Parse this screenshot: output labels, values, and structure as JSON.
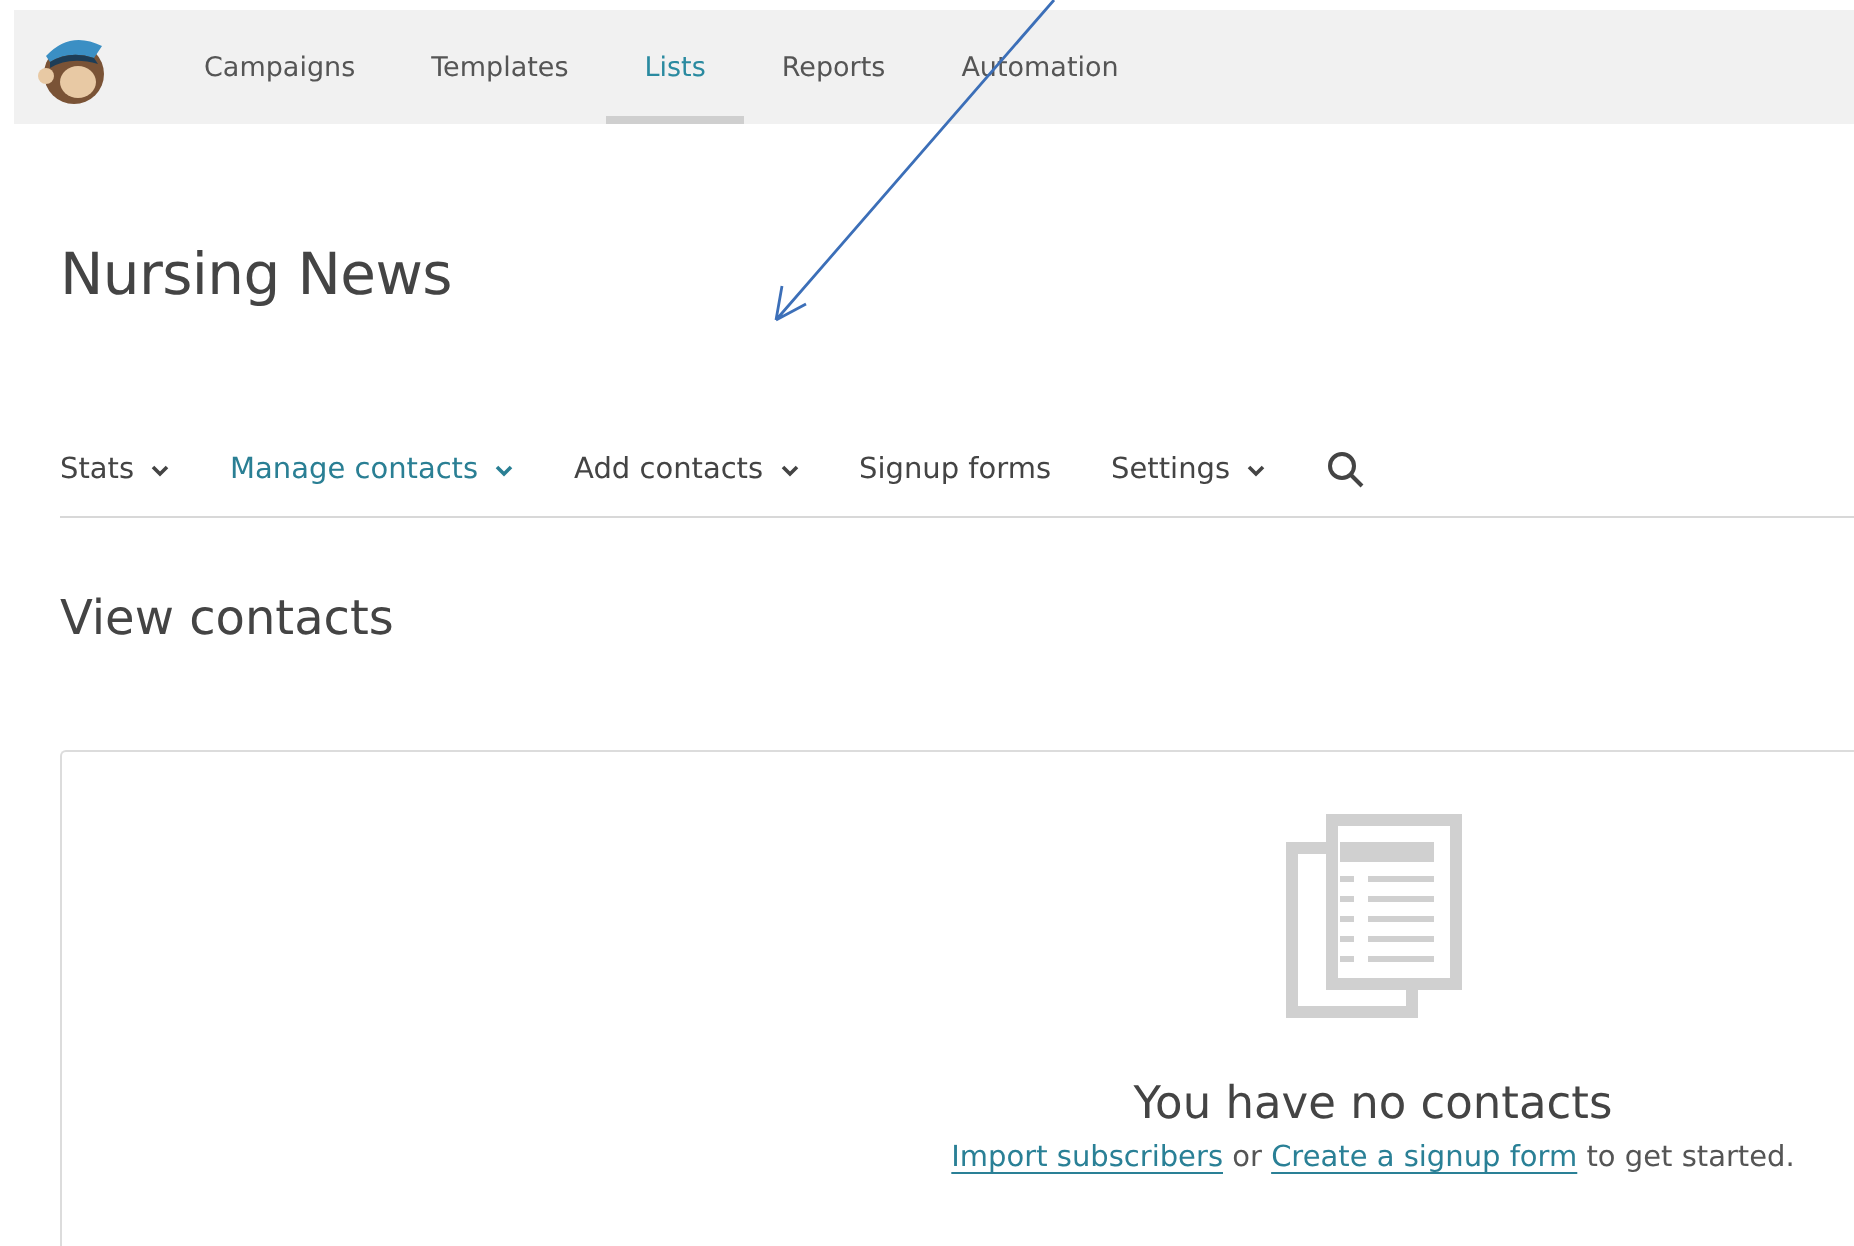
{
  "top_nav": [
    {
      "label": "Campaigns",
      "selected": false
    },
    {
      "label": "Templates",
      "selected": false
    },
    {
      "label": "Lists",
      "selected": true
    },
    {
      "label": "Reports",
      "selected": false
    },
    {
      "label": "Automation",
      "selected": false
    }
  ],
  "page_title": "Nursing News",
  "sub_nav": [
    {
      "label": "Stats",
      "selected": false,
      "dropdown": true
    },
    {
      "label": "Manage contacts",
      "selected": true,
      "dropdown": true
    },
    {
      "label": "Add contacts",
      "selected": false,
      "dropdown": true
    },
    {
      "label": "Signup forms",
      "selected": false,
      "dropdown": false
    },
    {
      "label": "Settings",
      "selected": false,
      "dropdown": true
    }
  ],
  "section_title": "View contacts",
  "empty_state": {
    "title": "You have no contacts",
    "message": [
      {
        "kind": "link",
        "text": "Import subscribers"
      },
      {
        "kind": "text",
        "text": " or "
      },
      {
        "kind": "link",
        "text": "Create a signup form"
      },
      {
        "kind": "text",
        "text": " to get started."
      }
    ]
  }
}
